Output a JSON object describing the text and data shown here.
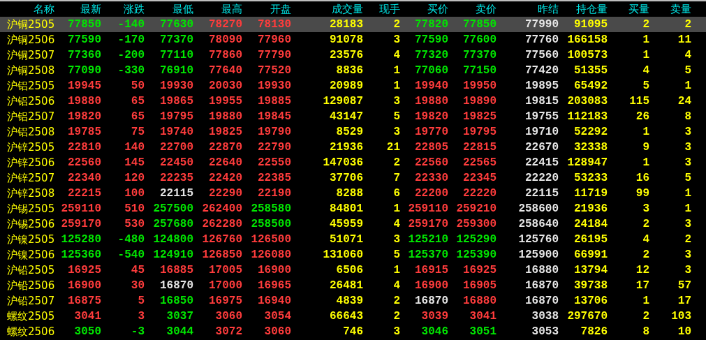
{
  "table": {
    "columns": [
      "名称",
      "最新",
      "涨跌",
      "最低",
      "最高",
      "开盘",
      "成交量",
      "现手",
      "买价",
      "卖价",
      "昨结",
      "持仓量",
      "买量",
      "卖量"
    ],
    "rows": [
      {
        "selected": true,
        "cells": [
          {
            "text": "沪铜2505",
            "color": "#ffff00"
          },
          {
            "text": "77850",
            "color": "#00e600"
          },
          {
            "text": "-140",
            "color": "#00e600"
          },
          {
            "text": "77630",
            "color": "#00e600"
          },
          {
            "text": "78270",
            "color": "#ff3c3c"
          },
          {
            "text": "78130",
            "color": "#ff3c3c"
          },
          {
            "text": "28183",
            "color": "#ffff00"
          },
          {
            "text": "2",
            "color": "#ffff00"
          },
          {
            "text": "77820",
            "color": "#00e600"
          },
          {
            "text": "77850",
            "color": "#00e600"
          },
          {
            "text": "77990",
            "color": "#e6e6e6"
          },
          {
            "text": "91095",
            "color": "#ffff00"
          },
          {
            "text": "2",
            "color": "#ffff00"
          },
          {
            "text": "2",
            "color": "#ffff00"
          }
        ]
      },
      {
        "selected": false,
        "cells": [
          {
            "text": "沪铜2506",
            "color": "#ffff00"
          },
          {
            "text": "77590",
            "color": "#00e600"
          },
          {
            "text": "-170",
            "color": "#00e600"
          },
          {
            "text": "77370",
            "color": "#00e600"
          },
          {
            "text": "78090",
            "color": "#ff3c3c"
          },
          {
            "text": "77960",
            "color": "#ff3c3c"
          },
          {
            "text": "91078",
            "color": "#ffff00"
          },
          {
            "text": "3",
            "color": "#ffff00"
          },
          {
            "text": "77590",
            "color": "#00e600"
          },
          {
            "text": "77600",
            "color": "#00e600"
          },
          {
            "text": "77760",
            "color": "#e6e6e6"
          },
          {
            "text": "166158",
            "color": "#ffff00"
          },
          {
            "text": "1",
            "color": "#ffff00"
          },
          {
            "text": "11",
            "color": "#ffff00"
          }
        ]
      },
      {
        "selected": false,
        "cells": [
          {
            "text": "沪铜2507",
            "color": "#ffff00"
          },
          {
            "text": "77360",
            "color": "#00e600"
          },
          {
            "text": "-200",
            "color": "#00e600"
          },
          {
            "text": "77110",
            "color": "#00e600"
          },
          {
            "text": "77860",
            "color": "#ff3c3c"
          },
          {
            "text": "77790",
            "color": "#ff3c3c"
          },
          {
            "text": "23576",
            "color": "#ffff00"
          },
          {
            "text": "4",
            "color": "#ffff00"
          },
          {
            "text": "77320",
            "color": "#00e600"
          },
          {
            "text": "77370",
            "color": "#00e600"
          },
          {
            "text": "77560",
            "color": "#e6e6e6"
          },
          {
            "text": "100573",
            "color": "#ffff00"
          },
          {
            "text": "1",
            "color": "#ffff00"
          },
          {
            "text": "4",
            "color": "#ffff00"
          }
        ]
      },
      {
        "selected": false,
        "cells": [
          {
            "text": "沪铜2508",
            "color": "#ffff00"
          },
          {
            "text": "77090",
            "color": "#00e600"
          },
          {
            "text": "-330",
            "color": "#00e600"
          },
          {
            "text": "76910",
            "color": "#00e600"
          },
          {
            "text": "77640",
            "color": "#ff3c3c"
          },
          {
            "text": "77520",
            "color": "#ff3c3c"
          },
          {
            "text": "8836",
            "color": "#ffff00"
          },
          {
            "text": "1",
            "color": "#ffff00"
          },
          {
            "text": "77060",
            "color": "#00e600"
          },
          {
            "text": "77150",
            "color": "#00e600"
          },
          {
            "text": "77420",
            "color": "#e6e6e6"
          },
          {
            "text": "51355",
            "color": "#ffff00"
          },
          {
            "text": "4",
            "color": "#ffff00"
          },
          {
            "text": "5",
            "color": "#ffff00"
          }
        ]
      },
      {
        "selected": false,
        "cells": [
          {
            "text": "沪铝2505",
            "color": "#ffff00"
          },
          {
            "text": "19945",
            "color": "#ff3c3c"
          },
          {
            "text": "50",
            "color": "#ff3c3c"
          },
          {
            "text": "19930",
            "color": "#ff3c3c"
          },
          {
            "text": "20030",
            "color": "#ff3c3c"
          },
          {
            "text": "19930",
            "color": "#ff3c3c"
          },
          {
            "text": "20989",
            "color": "#ffff00"
          },
          {
            "text": "1",
            "color": "#ffff00"
          },
          {
            "text": "19940",
            "color": "#ff3c3c"
          },
          {
            "text": "19950",
            "color": "#ff3c3c"
          },
          {
            "text": "19895",
            "color": "#e6e6e6"
          },
          {
            "text": "65492",
            "color": "#ffff00"
          },
          {
            "text": "5",
            "color": "#ffff00"
          },
          {
            "text": "1",
            "color": "#ffff00"
          }
        ]
      },
      {
        "selected": false,
        "cells": [
          {
            "text": "沪铝2506",
            "color": "#ffff00"
          },
          {
            "text": "19880",
            "color": "#ff3c3c"
          },
          {
            "text": "65",
            "color": "#ff3c3c"
          },
          {
            "text": "19865",
            "color": "#ff3c3c"
          },
          {
            "text": "19955",
            "color": "#ff3c3c"
          },
          {
            "text": "19885",
            "color": "#ff3c3c"
          },
          {
            "text": "129087",
            "color": "#ffff00"
          },
          {
            "text": "3",
            "color": "#ffff00"
          },
          {
            "text": "19880",
            "color": "#ff3c3c"
          },
          {
            "text": "19890",
            "color": "#ff3c3c"
          },
          {
            "text": "19815",
            "color": "#e6e6e6"
          },
          {
            "text": "203083",
            "color": "#ffff00"
          },
          {
            "text": "115",
            "color": "#ffff00"
          },
          {
            "text": "24",
            "color": "#ffff00"
          }
        ]
      },
      {
        "selected": false,
        "cells": [
          {
            "text": "沪铝2507",
            "color": "#ffff00"
          },
          {
            "text": "19820",
            "color": "#ff3c3c"
          },
          {
            "text": "65",
            "color": "#ff3c3c"
          },
          {
            "text": "19795",
            "color": "#ff3c3c"
          },
          {
            "text": "19880",
            "color": "#ff3c3c"
          },
          {
            "text": "19845",
            "color": "#ff3c3c"
          },
          {
            "text": "43147",
            "color": "#ffff00"
          },
          {
            "text": "5",
            "color": "#ffff00"
          },
          {
            "text": "19820",
            "color": "#ff3c3c"
          },
          {
            "text": "19825",
            "color": "#ff3c3c"
          },
          {
            "text": "19755",
            "color": "#e6e6e6"
          },
          {
            "text": "112183",
            "color": "#ffff00"
          },
          {
            "text": "26",
            "color": "#ffff00"
          },
          {
            "text": "8",
            "color": "#ffff00"
          }
        ]
      },
      {
        "selected": false,
        "cells": [
          {
            "text": "沪铝2508",
            "color": "#ffff00"
          },
          {
            "text": "19785",
            "color": "#ff3c3c"
          },
          {
            "text": "75",
            "color": "#ff3c3c"
          },
          {
            "text": "19740",
            "color": "#ff3c3c"
          },
          {
            "text": "19825",
            "color": "#ff3c3c"
          },
          {
            "text": "19790",
            "color": "#ff3c3c"
          },
          {
            "text": "8529",
            "color": "#ffff00"
          },
          {
            "text": "3",
            "color": "#ffff00"
          },
          {
            "text": "19770",
            "color": "#ff3c3c"
          },
          {
            "text": "19795",
            "color": "#ff3c3c"
          },
          {
            "text": "19710",
            "color": "#e6e6e6"
          },
          {
            "text": "52292",
            "color": "#ffff00"
          },
          {
            "text": "1",
            "color": "#ffff00"
          },
          {
            "text": "3",
            "color": "#ffff00"
          }
        ]
      },
      {
        "selected": false,
        "cells": [
          {
            "text": "沪锌2505",
            "color": "#ffff00"
          },
          {
            "text": "22810",
            "color": "#ff3c3c"
          },
          {
            "text": "140",
            "color": "#ff3c3c"
          },
          {
            "text": "22700",
            "color": "#ff3c3c"
          },
          {
            "text": "22870",
            "color": "#ff3c3c"
          },
          {
            "text": "22790",
            "color": "#ff3c3c"
          },
          {
            "text": "21936",
            "color": "#ffff00"
          },
          {
            "text": "21",
            "color": "#ffff00"
          },
          {
            "text": "22805",
            "color": "#ff3c3c"
          },
          {
            "text": "22815",
            "color": "#ff3c3c"
          },
          {
            "text": "22670",
            "color": "#e6e6e6"
          },
          {
            "text": "32338",
            "color": "#ffff00"
          },
          {
            "text": "9",
            "color": "#ffff00"
          },
          {
            "text": "3",
            "color": "#ffff00"
          }
        ]
      },
      {
        "selected": false,
        "cells": [
          {
            "text": "沪锌2506",
            "color": "#ffff00"
          },
          {
            "text": "22560",
            "color": "#ff3c3c"
          },
          {
            "text": "145",
            "color": "#ff3c3c"
          },
          {
            "text": "22450",
            "color": "#ff3c3c"
          },
          {
            "text": "22640",
            "color": "#ff3c3c"
          },
          {
            "text": "22550",
            "color": "#ff3c3c"
          },
          {
            "text": "147036",
            "color": "#ffff00"
          },
          {
            "text": "2",
            "color": "#ffff00"
          },
          {
            "text": "22560",
            "color": "#ff3c3c"
          },
          {
            "text": "22565",
            "color": "#ff3c3c"
          },
          {
            "text": "22415",
            "color": "#e6e6e6"
          },
          {
            "text": "128947",
            "color": "#ffff00"
          },
          {
            "text": "1",
            "color": "#ffff00"
          },
          {
            "text": "3",
            "color": "#ffff00"
          }
        ]
      },
      {
        "selected": false,
        "cells": [
          {
            "text": "沪锌2507",
            "color": "#ffff00"
          },
          {
            "text": "22340",
            "color": "#ff3c3c"
          },
          {
            "text": "120",
            "color": "#ff3c3c"
          },
          {
            "text": "22235",
            "color": "#ff3c3c"
          },
          {
            "text": "22420",
            "color": "#ff3c3c"
          },
          {
            "text": "22385",
            "color": "#ff3c3c"
          },
          {
            "text": "37706",
            "color": "#ffff00"
          },
          {
            "text": "7",
            "color": "#ffff00"
          },
          {
            "text": "22330",
            "color": "#ff3c3c"
          },
          {
            "text": "22345",
            "color": "#ff3c3c"
          },
          {
            "text": "22220",
            "color": "#e6e6e6"
          },
          {
            "text": "53233",
            "color": "#ffff00"
          },
          {
            "text": "16",
            "color": "#ffff00"
          },
          {
            "text": "5",
            "color": "#ffff00"
          }
        ]
      },
      {
        "selected": false,
        "cells": [
          {
            "text": "沪锌2508",
            "color": "#ffff00"
          },
          {
            "text": "22215",
            "color": "#ff3c3c"
          },
          {
            "text": "100",
            "color": "#ff3c3c"
          },
          {
            "text": "22115",
            "color": "#e6e6e6"
          },
          {
            "text": "22290",
            "color": "#ff3c3c"
          },
          {
            "text": "22190",
            "color": "#ff3c3c"
          },
          {
            "text": "8288",
            "color": "#ffff00"
          },
          {
            "text": "6",
            "color": "#ffff00"
          },
          {
            "text": "22200",
            "color": "#ff3c3c"
          },
          {
            "text": "22220",
            "color": "#ff3c3c"
          },
          {
            "text": "22115",
            "color": "#e6e6e6"
          },
          {
            "text": "11719",
            "color": "#ffff00"
          },
          {
            "text": "99",
            "color": "#ffff00"
          },
          {
            "text": "1",
            "color": "#ffff00"
          }
        ]
      },
      {
        "selected": false,
        "cells": [
          {
            "text": "沪锡2505",
            "color": "#ffff00"
          },
          {
            "text": "259110",
            "color": "#ff3c3c"
          },
          {
            "text": "510",
            "color": "#ff3c3c"
          },
          {
            "text": "257500",
            "color": "#00e600"
          },
          {
            "text": "262400",
            "color": "#ff3c3c"
          },
          {
            "text": "258580",
            "color": "#00e600"
          },
          {
            "text": "84801",
            "color": "#ffff00"
          },
          {
            "text": "1",
            "color": "#ffff00"
          },
          {
            "text": "259110",
            "color": "#ff3c3c"
          },
          {
            "text": "259210",
            "color": "#ff3c3c"
          },
          {
            "text": "258600",
            "color": "#e6e6e6"
          },
          {
            "text": "21936",
            "color": "#ffff00"
          },
          {
            "text": "3",
            "color": "#ffff00"
          },
          {
            "text": "1",
            "color": "#ffff00"
          }
        ]
      },
      {
        "selected": false,
        "cells": [
          {
            "text": "沪锡2506",
            "color": "#ffff00"
          },
          {
            "text": "259170",
            "color": "#ff3c3c"
          },
          {
            "text": "530",
            "color": "#ff3c3c"
          },
          {
            "text": "257680",
            "color": "#00e600"
          },
          {
            "text": "262280",
            "color": "#ff3c3c"
          },
          {
            "text": "258500",
            "color": "#00e600"
          },
          {
            "text": "45959",
            "color": "#ffff00"
          },
          {
            "text": "4",
            "color": "#ffff00"
          },
          {
            "text": "259170",
            "color": "#ff3c3c"
          },
          {
            "text": "259300",
            "color": "#ff3c3c"
          },
          {
            "text": "258640",
            "color": "#e6e6e6"
          },
          {
            "text": "24184",
            "color": "#ffff00"
          },
          {
            "text": "2",
            "color": "#ffff00"
          },
          {
            "text": "3",
            "color": "#ffff00"
          }
        ]
      },
      {
        "selected": false,
        "cells": [
          {
            "text": "沪镍2505",
            "color": "#ffff00"
          },
          {
            "text": "125280",
            "color": "#00e600"
          },
          {
            "text": "-480",
            "color": "#00e600"
          },
          {
            "text": "124800",
            "color": "#00e600"
          },
          {
            "text": "126760",
            "color": "#ff3c3c"
          },
          {
            "text": "126500",
            "color": "#ff3c3c"
          },
          {
            "text": "51071",
            "color": "#ffff00"
          },
          {
            "text": "3",
            "color": "#ffff00"
          },
          {
            "text": "125210",
            "color": "#00e600"
          },
          {
            "text": "125290",
            "color": "#00e600"
          },
          {
            "text": "125760",
            "color": "#e6e6e6"
          },
          {
            "text": "26195",
            "color": "#ffff00"
          },
          {
            "text": "4",
            "color": "#ffff00"
          },
          {
            "text": "2",
            "color": "#ffff00"
          }
        ]
      },
      {
        "selected": false,
        "cells": [
          {
            "text": "沪镍2506",
            "color": "#ffff00"
          },
          {
            "text": "125360",
            "color": "#00e600"
          },
          {
            "text": "-540",
            "color": "#00e600"
          },
          {
            "text": "124910",
            "color": "#00e600"
          },
          {
            "text": "126850",
            "color": "#ff3c3c"
          },
          {
            "text": "126080",
            "color": "#ff3c3c"
          },
          {
            "text": "131060",
            "color": "#ffff00"
          },
          {
            "text": "5",
            "color": "#ffff00"
          },
          {
            "text": "125370",
            "color": "#00e600"
          },
          {
            "text": "125390",
            "color": "#00e600"
          },
          {
            "text": "125900",
            "color": "#e6e6e6"
          },
          {
            "text": "66991",
            "color": "#ffff00"
          },
          {
            "text": "2",
            "color": "#ffff00"
          },
          {
            "text": "3",
            "color": "#ffff00"
          }
        ]
      },
      {
        "selected": false,
        "cells": [
          {
            "text": "沪铅2505",
            "color": "#ffff00"
          },
          {
            "text": "16925",
            "color": "#ff3c3c"
          },
          {
            "text": "45",
            "color": "#ff3c3c"
          },
          {
            "text": "16885",
            "color": "#ff3c3c"
          },
          {
            "text": "17005",
            "color": "#ff3c3c"
          },
          {
            "text": "16900",
            "color": "#ff3c3c"
          },
          {
            "text": "6506",
            "color": "#ffff00"
          },
          {
            "text": "1",
            "color": "#ffff00"
          },
          {
            "text": "16915",
            "color": "#ff3c3c"
          },
          {
            "text": "16925",
            "color": "#ff3c3c"
          },
          {
            "text": "16880",
            "color": "#e6e6e6"
          },
          {
            "text": "13794",
            "color": "#ffff00"
          },
          {
            "text": "12",
            "color": "#ffff00"
          },
          {
            "text": "3",
            "color": "#ffff00"
          }
        ]
      },
      {
        "selected": false,
        "cells": [
          {
            "text": "沪铅2506",
            "color": "#ffff00"
          },
          {
            "text": "16900",
            "color": "#ff3c3c"
          },
          {
            "text": "30",
            "color": "#ff3c3c"
          },
          {
            "text": "16870",
            "color": "#e6e6e6"
          },
          {
            "text": "17000",
            "color": "#ff3c3c"
          },
          {
            "text": "16965",
            "color": "#ff3c3c"
          },
          {
            "text": "26481",
            "color": "#ffff00"
          },
          {
            "text": "4",
            "color": "#ffff00"
          },
          {
            "text": "16900",
            "color": "#ff3c3c"
          },
          {
            "text": "16905",
            "color": "#ff3c3c"
          },
          {
            "text": "16870",
            "color": "#e6e6e6"
          },
          {
            "text": "39738",
            "color": "#ffff00"
          },
          {
            "text": "17",
            "color": "#ffff00"
          },
          {
            "text": "57",
            "color": "#ffff00"
          }
        ]
      },
      {
        "selected": false,
        "cells": [
          {
            "text": "沪铅2507",
            "color": "#ffff00"
          },
          {
            "text": "16875",
            "color": "#ff3c3c"
          },
          {
            "text": "5",
            "color": "#ff3c3c"
          },
          {
            "text": "16850",
            "color": "#00e600"
          },
          {
            "text": "16975",
            "color": "#ff3c3c"
          },
          {
            "text": "16940",
            "color": "#ff3c3c"
          },
          {
            "text": "4839",
            "color": "#ffff00"
          },
          {
            "text": "2",
            "color": "#ffff00"
          },
          {
            "text": "16870",
            "color": "#e6e6e6"
          },
          {
            "text": "16880",
            "color": "#ff3c3c"
          },
          {
            "text": "16870",
            "color": "#e6e6e6"
          },
          {
            "text": "13706",
            "color": "#ffff00"
          },
          {
            "text": "1",
            "color": "#ffff00"
          },
          {
            "text": "17",
            "color": "#ffff00"
          }
        ]
      },
      {
        "selected": false,
        "cells": [
          {
            "text": "螺纹2505",
            "color": "#ffff00"
          },
          {
            "text": "3041",
            "color": "#ff3c3c"
          },
          {
            "text": "3",
            "color": "#ff3c3c"
          },
          {
            "text": "3037",
            "color": "#00e600"
          },
          {
            "text": "3060",
            "color": "#ff3c3c"
          },
          {
            "text": "3054",
            "color": "#ff3c3c"
          },
          {
            "text": "66643",
            "color": "#ffff00"
          },
          {
            "text": "2",
            "color": "#ffff00"
          },
          {
            "text": "3039",
            "color": "#ff3c3c"
          },
          {
            "text": "3041",
            "color": "#ff3c3c"
          },
          {
            "text": "3038",
            "color": "#e6e6e6"
          },
          {
            "text": "297670",
            "color": "#ffff00"
          },
          {
            "text": "2",
            "color": "#ffff00"
          },
          {
            "text": "103",
            "color": "#ffff00"
          }
        ]
      },
      {
        "selected": false,
        "cells": [
          {
            "text": "螺纹2506",
            "color": "#ffff00"
          },
          {
            "text": "3050",
            "color": "#00e600"
          },
          {
            "text": "-3",
            "color": "#00e600"
          },
          {
            "text": "3044",
            "color": "#00e600"
          },
          {
            "text": "3072",
            "color": "#ff3c3c"
          },
          {
            "text": "3060",
            "color": "#ff3c3c"
          },
          {
            "text": "746",
            "color": "#ffff00"
          },
          {
            "text": "3",
            "color": "#ffff00"
          },
          {
            "text": "3046",
            "color": "#00e600"
          },
          {
            "text": "3051",
            "color": "#00e600"
          },
          {
            "text": "3053",
            "color": "#e6e6e6"
          },
          {
            "text": "7826",
            "color": "#ffff00"
          },
          {
            "text": "8",
            "color": "#ffff00"
          },
          {
            "text": "10",
            "color": "#ffff00"
          }
        ]
      }
    ]
  }
}
